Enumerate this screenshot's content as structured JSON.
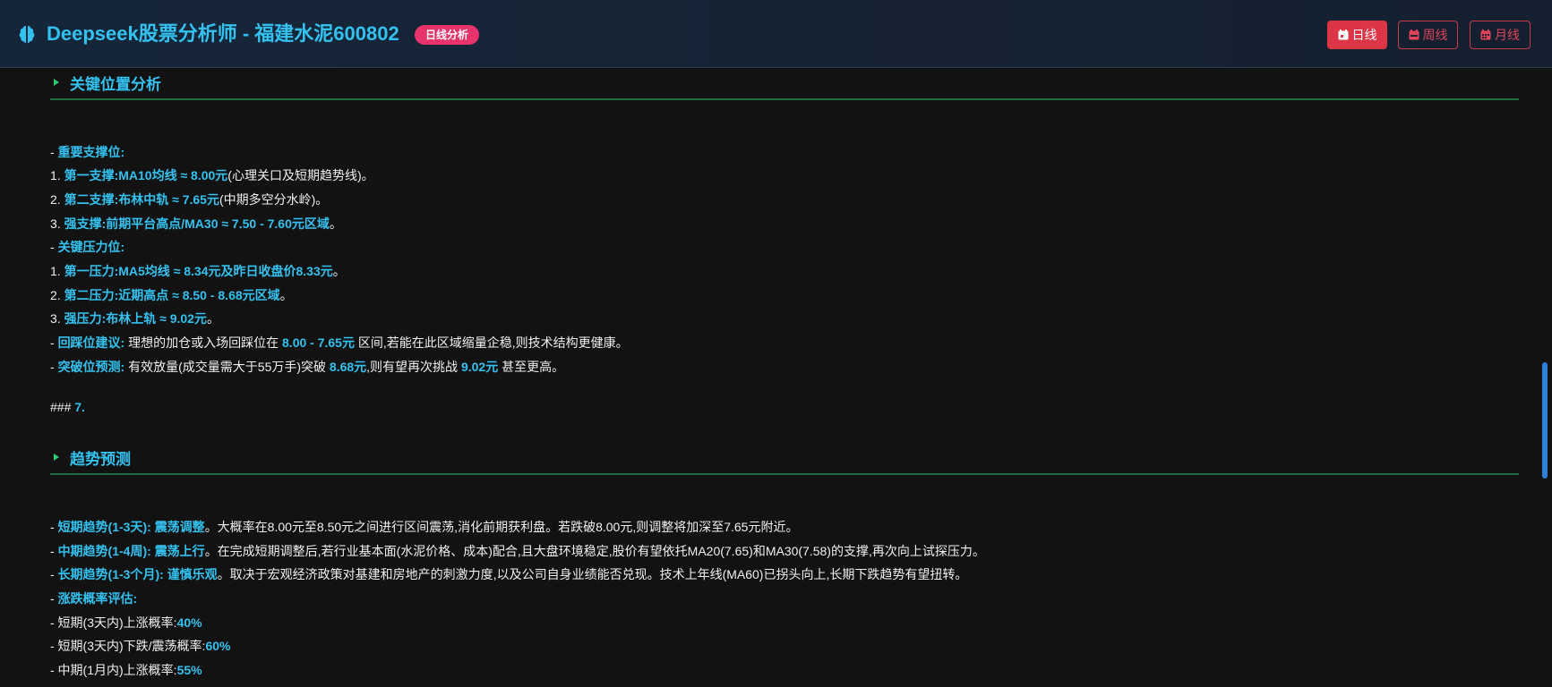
{
  "header": {
    "title": "Deepseek股票分析师 - 福建水泥600802",
    "badge": "日线分析",
    "buttons": {
      "day": "日线",
      "week": "周线",
      "month": "月线"
    },
    "active_period": "日线"
  },
  "section_key_levels": {
    "heading": "关键位置分析",
    "lines": {
      "l1_a": "- ",
      "l1_b": "重要支撑位:",
      "l2_a": "1. ",
      "l2_b": "第一支撑:MA10均线 ≈ 8.00元",
      "l2_c": "(心理关口及短期趋势线)。",
      "l3_a": "2. ",
      "l3_b": "第二支撑:布林中轨 ≈ 7.65元",
      "l3_c": "(中期多空分水岭)。",
      "l4_a": "3. ",
      "l4_b": "强支撑:前期平台高点/MA30 ≈ 7.50 - 7.60元区域",
      "l4_c": "。",
      "l5_a": "- ",
      "l5_b": "关键压力位:",
      "l6_a": "1. ",
      "l6_b": "第一压力:MA5均线 ≈ 8.34元及昨日收盘价8.33元",
      "l6_c": "。",
      "l7_a": "2. ",
      "l7_b": "第二压力:近期高点 ≈ 8.50 - 8.68元区域",
      "l7_c": "。",
      "l8_a": "3. ",
      "l8_b": "强压力:布林上轨 ≈ 9.02元",
      "l8_c": "。",
      "l9_a": "- ",
      "l9_b": "回踩位建议:",
      "l9_c": " 理想的加仓或入场回踩位在 ",
      "l9_d": "8.00 - 7.65元",
      "l9_e": " 区间,若能在此区域缩量企稳,则技术结构更健康。",
      "l10_a": "- ",
      "l10_b": "突破位预测:",
      "l10_c": " 有效放量(成交量需大于55万手)突破 ",
      "l10_d": "8.68元",
      "l10_e": ",则有望再次挑战 ",
      "l10_f": "9.02元",
      "l10_g": " 甚至更高。",
      "l11_a": "### ",
      "l11_b": "7."
    }
  },
  "section_trend": {
    "heading": "趋势预测",
    "lines": {
      "t1_a": "- ",
      "t1_b": "短期趋势(1-3天):",
      "t1_c": " ",
      "t1_d": "震荡调整",
      "t1_e": "。大概率在8.00元至8.50元之间进行区间震荡,消化前期获利盘。若跌破8.00元,则调整将加深至7.65元附近。",
      "t2_a": "- ",
      "t2_b": "中期趋势(1-4周):",
      "t2_c": " ",
      "t2_d": "震荡上行",
      "t2_e": "。在完成短期调整后,若行业基本面(水泥价格、成本)配合,且大盘环境稳定,股价有望依托MA20(7.65)和MA30(7.58)的支撑,再次向上试探压力。",
      "t3_a": "- ",
      "t3_b": "长期趋势(1-3个月):",
      "t3_c": " ",
      "t3_d": "谨慎乐观",
      "t3_e": "。取决于宏观经济政策对基建和房地产的刺激力度,以及公司自身业绩能否兑现。技术上年线(MA60)已拐头向上,长期下跌趋势有望扭转。",
      "t4_a": "- ",
      "t4_b": "涨跌概率评估:",
      "t5_a": "- 短期(3天内)上涨概率:",
      "t5_b": "40%",
      "t6_a": "- 短期(3天内)下跌/震荡概率:",
      "t6_b": "60%",
      "t7_a": "- 中期(1月内)上涨概率:",
      "t7_b": "55%"
    }
  },
  "colors": {
    "accent": "#33c2f0",
    "heading_marker": "#2ecc71",
    "rule": "#1e6b3c",
    "active_btn": "#dc3545",
    "badge": "#e8336d"
  }
}
